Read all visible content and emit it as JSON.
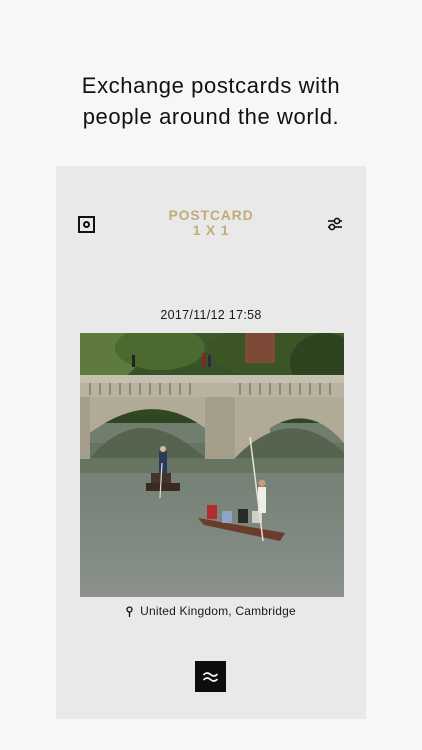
{
  "headline": {
    "line1": "Exchange postcards with",
    "line2": "people around the world."
  },
  "app": {
    "logo_line1": "POSTCARD",
    "logo_line2": "1 X 1",
    "logo_color": "#c2ac7c",
    "camera_icon": "camera-frame-icon",
    "settings_icon": "sliders-icon"
  },
  "postcard": {
    "datetime": "2017/11/12 17:58",
    "location": "United Kingdom, Cambridge",
    "location_icon": "pin-icon",
    "photo_description_icon": "photo"
  },
  "bottom": {
    "wave_icon": "wave-icon"
  }
}
